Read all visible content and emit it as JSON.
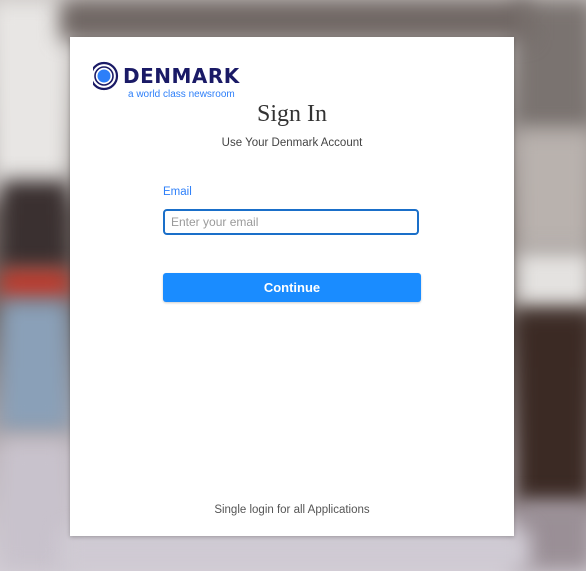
{
  "brand": {
    "name": "DENMARK",
    "tagline": "a world class newsroom",
    "logo_icon": "denmark-d-logo-icon",
    "primary_color": "#1a1a66",
    "accent_color": "#2d7ff9"
  },
  "signin": {
    "title": "Sign In",
    "subtitle": "Use Your Denmark Account",
    "email_label": "Email",
    "email_placeholder": "Enter your email",
    "email_value": "",
    "continue_label": "Continue",
    "button_color": "#1a8cff",
    "footer": "Single login for all Applications"
  }
}
